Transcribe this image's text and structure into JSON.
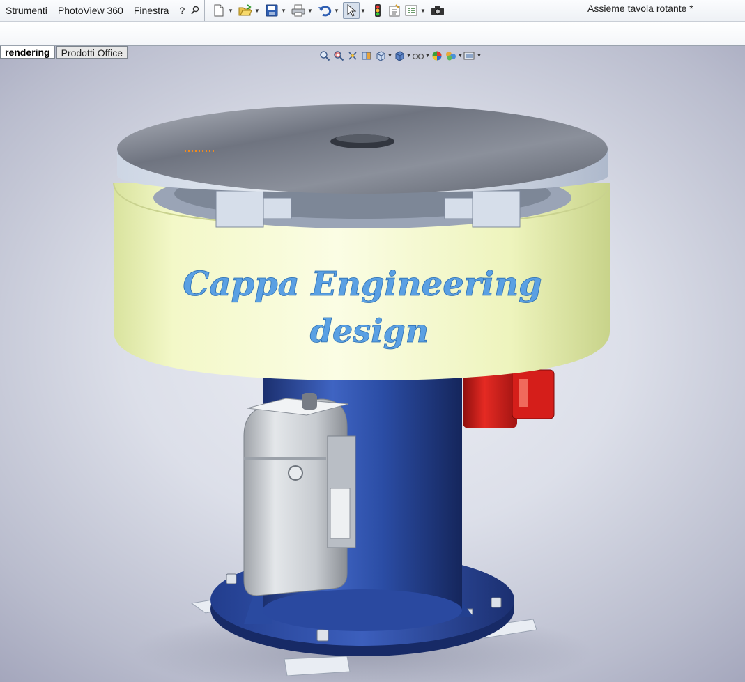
{
  "menu": {
    "items": [
      "Strumenti",
      "PhotoView 360",
      "Finestra",
      "?"
    ]
  },
  "toolbar": {
    "buttons": [
      "new-document-icon",
      "open-folder-icon",
      "save-icon",
      "print-icon",
      "undo-icon",
      "select-pointer-icon",
      "traffic-light-icon",
      "file-properties-icon",
      "options-list-icon",
      "camera-icon"
    ]
  },
  "document": {
    "title": "Assieme tavola rotante *"
  },
  "tabs": {
    "active": "rendering",
    "inactive": "Prodotti Office"
  },
  "heads_up": {
    "buttons": [
      "zoom-to-fit-icon",
      "zoom-area-icon",
      "previous-view-icon",
      "section-view-icon",
      "view-orientation-icon",
      "display-style-icon",
      "hide-show-items-icon",
      "edit-appearance-icon",
      "apply-scene-icon",
      "view-settings-icon"
    ]
  },
  "model": {
    "caption_line1": "Cappa Engineering",
    "caption_line2": "design"
  },
  "colors": {
    "base_blue": "#2d4fa6",
    "band_yellow": "#f3f7c2",
    "motor_red": "#d8201e",
    "caption_blue": "#5aa0e3",
    "table_steel": "#7c818c"
  }
}
